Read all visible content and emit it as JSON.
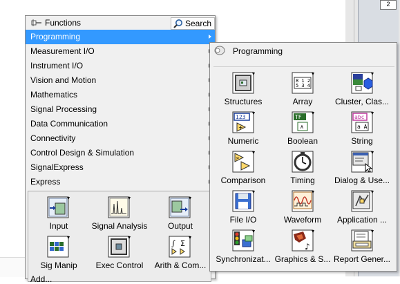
{
  "background": {
    "indicator_value": "2"
  },
  "palette": {
    "title": "Functions",
    "search_label": "Search",
    "menu": [
      {
        "label": "Programming",
        "selected": true
      },
      {
        "label": "Measurement I/O"
      },
      {
        "label": "Instrument I/O"
      },
      {
        "label": "Vision and Motion"
      },
      {
        "label": "Mathematics"
      },
      {
        "label": "Signal Processing"
      },
      {
        "label": "Data Communication"
      },
      {
        "label": "Connectivity"
      },
      {
        "label": "Control Design & Simulation"
      },
      {
        "label": "SignalExpress"
      },
      {
        "label": "Express"
      }
    ],
    "express_items": [
      {
        "label": "Input",
        "icon": "input-icon"
      },
      {
        "label": "Signal Analysis",
        "icon": "signal-analysis-icon"
      },
      {
        "label": "Output",
        "icon": "output-icon"
      },
      {
        "label": "Sig Manip",
        "icon": "sig-manip-icon"
      },
      {
        "label": "Exec Control",
        "icon": "exec-control-icon"
      },
      {
        "label": "Arith & Com...",
        "icon": "arith-comparison-icon"
      }
    ],
    "bottom_item": "Add..."
  },
  "programming": {
    "title": "Programming",
    "items": [
      {
        "label": "Structures",
        "icon": "structures-icon"
      },
      {
        "label": "Array",
        "icon": "array-icon"
      },
      {
        "label": "Cluster, Clas...",
        "icon": "cluster-icon"
      },
      {
        "label": "Numeric",
        "icon": "numeric-icon"
      },
      {
        "label": "Boolean",
        "icon": "boolean-icon"
      },
      {
        "label": "String",
        "icon": "string-icon"
      },
      {
        "label": "Comparison",
        "icon": "comparison-icon"
      },
      {
        "label": "Timing",
        "icon": "timing-icon"
      },
      {
        "label": "Dialog & Use...",
        "icon": "dialog-icon"
      },
      {
        "label": "File I/O",
        "icon": "file-io-icon"
      },
      {
        "label": "Waveform",
        "icon": "waveform-icon"
      },
      {
        "label": "Application ...",
        "icon": "application-control-icon"
      },
      {
        "label": "Synchronizat...",
        "icon": "synchronization-icon"
      },
      {
        "label": "Graphics & S...",
        "icon": "graphics-sound-icon"
      },
      {
        "label": "Report Gener...",
        "icon": "report-generation-icon"
      }
    ]
  }
}
